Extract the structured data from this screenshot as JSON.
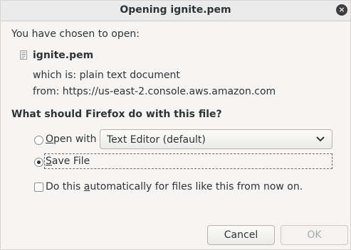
{
  "window": {
    "title": "Opening ignite.pem",
    "close_glyph": "×"
  },
  "intro": "You have chosen to open:",
  "file": {
    "icon": "text-file-icon",
    "name": "ignite.pem",
    "which_is": "which is:  plain text document",
    "from": "from:  https://us-east-2.console.aws.amazon.com"
  },
  "question": "What should Firefox do with this file?",
  "options": {
    "open_with": {
      "label_prefix": "",
      "label_mnemonic": "O",
      "label_rest": "pen with",
      "checked": false,
      "app_select": {
        "value": "Text Editor (default)",
        "icon": "chevron-down-icon"
      }
    },
    "save_file": {
      "label_mnemonic": "S",
      "label_rest": "ave File",
      "checked": true
    }
  },
  "auto_checkbox": {
    "label_before": "Do this ",
    "label_mnemonic": "a",
    "label_after": "utomatically for files like this from now on.",
    "checked": false
  },
  "buttons": {
    "cancel": "Cancel",
    "ok": "OK",
    "ok_enabled": false
  }
}
